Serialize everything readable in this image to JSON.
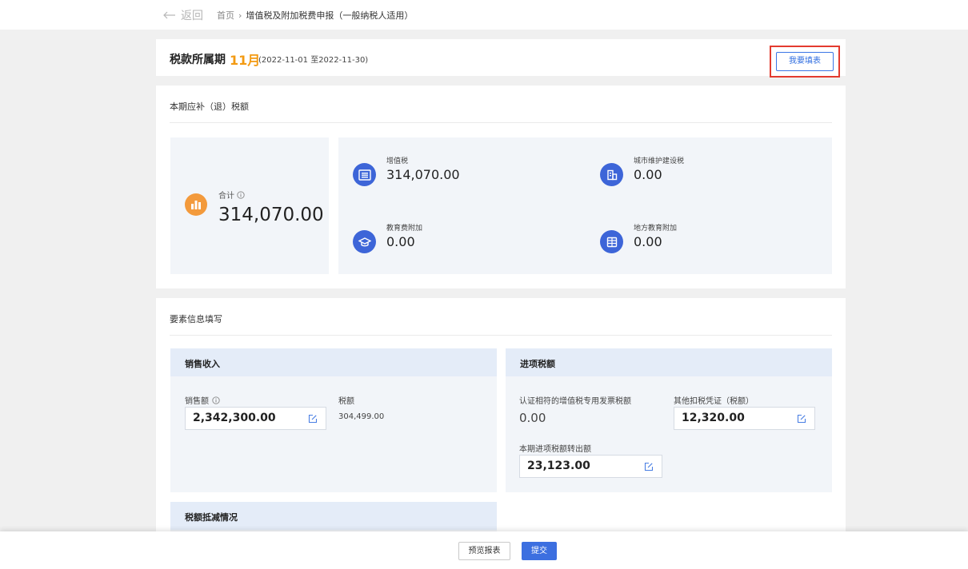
{
  "nav": {
    "back_label": "返回",
    "breadcrumb": {
      "home": "首页",
      "current": "增值税及附加税费申报（一般纳税人适用）"
    }
  },
  "period": {
    "label": "税款所属期",
    "month": "11月",
    "range": "(2022-11-01 至2022-11-30)",
    "fill_button": "我要填表"
  },
  "tax_summary": {
    "title": "本期应补（退）税额",
    "total": {
      "label": "合计",
      "value": "314,070.00"
    },
    "items": [
      {
        "label": "增值税",
        "value": "314,070.00",
        "icon": "tax-document-icon"
      },
      {
        "label": "城市维护建设税",
        "value": "0.00",
        "icon": "building-icon"
      },
      {
        "label": "教育费附加",
        "value": "0.00",
        "icon": "graduation-cap-icon"
      },
      {
        "label": "地方教育附加",
        "value": "0.00",
        "icon": "grid-table-icon"
      }
    ]
  },
  "elements": {
    "title": "要素信息填写",
    "sales": {
      "title": "销售收入",
      "amount_label": "销售额",
      "amount_value": "2,342,300.00",
      "tax_label": "税额",
      "tax_value": "304,499.00"
    },
    "input_tax": {
      "title": "进项税额",
      "certified_label": "认证相符的增值税专用发票税额",
      "certified_value": "0.00",
      "other_label": "其他扣税凭证（税额）",
      "other_value": "12,320.00",
      "transfer_label": "本期进项税额转出额",
      "transfer_value": "23,123.00"
    },
    "deduction": {
      "title": "税额抵减情况"
    }
  },
  "footer": {
    "preview_button": "预览报表",
    "submit_button": "提交"
  },
  "colors": {
    "accent": "#3c6fe0",
    "highlight": "#f39a12",
    "red_frame": "#e33b2f",
    "icon_blue": "#3d65d8",
    "icon_orange": "#f39a3c"
  }
}
